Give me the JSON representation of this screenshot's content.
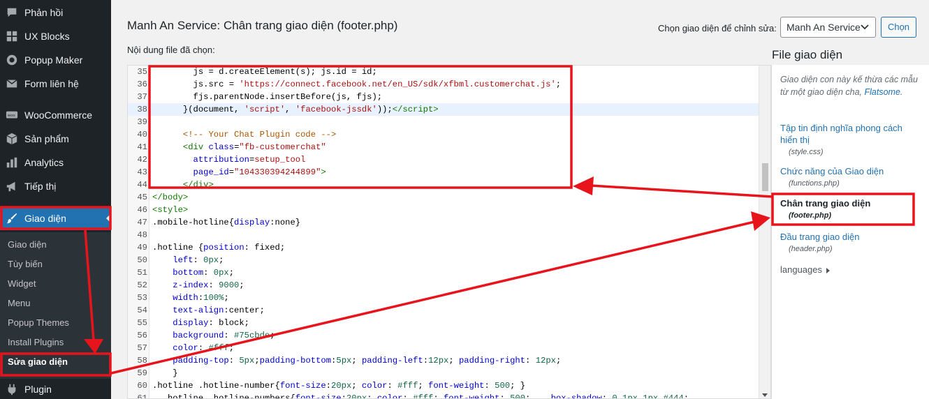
{
  "sidebar": {
    "items": [
      {
        "label": "Phản hồi",
        "icon": "comment-icon"
      },
      {
        "label": "UX Blocks",
        "icon": "blocks-icon"
      },
      {
        "label": "Popup Maker",
        "icon": "popup-icon"
      },
      {
        "label": "Form liên hệ",
        "icon": "mail-icon"
      },
      {
        "label": "WooCommerce",
        "icon": "woo-icon"
      },
      {
        "label": "Sản phẩm",
        "icon": "archive-icon"
      },
      {
        "label": "Analytics",
        "icon": "chart-icon"
      },
      {
        "label": "Tiếp thị",
        "icon": "megaphone-icon"
      },
      {
        "label": "Giao diện",
        "icon": "brush-icon"
      },
      {
        "label": "Plugin",
        "icon": "plugin-icon"
      }
    ],
    "submenu": [
      "Giao diện",
      "Tùy biến",
      "Widget",
      "Menu",
      "Popup Themes",
      "Install Plugins",
      "Sửa giao diện"
    ]
  },
  "header": {
    "title": "Manh An Service: Chân trang giao diện (footer.php)",
    "choose_label": "Chọn giao diện để chỉnh sửa:",
    "select_value": "Manh An Service",
    "choose_button": "Chọn",
    "selected_label": "Nội dung file đã chọn:"
  },
  "editor": {
    "lines": [
      {
        "n": "35",
        "html": "        js = d.createElement(s); js.id = id;"
      },
      {
        "n": "36",
        "html": "        js.src = <span class=\"t-str\">'https://connect.facebook.net/en_US/sdk/xfbml.customerchat.js'</span>;"
      },
      {
        "n": "37",
        "html": "        fjs.parentNode.insertBefore(js, fjs);"
      },
      {
        "n": "38",
        "html": "      }(document, <span class=\"t-str\">'script'</span>, <span class=\"t-str\">'facebook-jssdk'</span>));<span class=\"t-tag\">&lt;/script&gt;</span>",
        "hl": true
      },
      {
        "n": "39",
        "html": ""
      },
      {
        "n": "40",
        "html": "      <span class=\"t-com\">&lt;!-- Your Chat Plugin code --&gt;</span>"
      },
      {
        "n": "41",
        "html": "      <span class=\"t-tag\">&lt;div</span> <span class=\"t-att\">class</span>=<span class=\"t-str\">\"fb-customerchat\"</span>"
      },
      {
        "n": "42",
        "html": "        <span class=\"t-att\">attribution</span>=<span class=\"t-str\">setup_tool</span>"
      },
      {
        "n": "43",
        "html": "        <span class=\"t-att\">page_id</span>=<span class=\"t-str\">\"104330394244899\"</span><span class=\"t-tag\">&gt;</span>"
      },
      {
        "n": "44",
        "html": "      <span class=\"t-tag\">&lt;/div&gt;</span>"
      },
      {
        "n": "45",
        "html": "<span class=\"t-tag\">&lt;/body&gt;</span>"
      },
      {
        "n": "46",
        "html": "<span class=\"t-tag\">&lt;style&gt;</span>"
      },
      {
        "n": "47",
        "html": ".mobile-hotline{<span class=\"t-att\">display</span>:none}"
      },
      {
        "n": "48",
        "html": ""
      },
      {
        "n": "49",
        "html": ".hotline {<span class=\"t-att\">position</span>: fixed;"
      },
      {
        "n": "50",
        "html": "    <span class=\"t-att\">left</span>: <span class=\"t-num\">0px</span>;"
      },
      {
        "n": "51",
        "html": "    <span class=\"t-att\">bottom</span>: <span class=\"t-num\">0px</span>;"
      },
      {
        "n": "52",
        "html": "    <span class=\"t-att\">z-index</span>: <span class=\"t-num\">9000</span>;"
      },
      {
        "n": "53",
        "html": "    <span class=\"t-att\">width</span>:<span class=\"t-num\">100%</span>;"
      },
      {
        "n": "54",
        "html": "    <span class=\"t-att\">text-align</span>:center;"
      },
      {
        "n": "55",
        "html": "    <span class=\"t-att\">display</span>: block;"
      },
      {
        "n": "56",
        "html": "    <span class=\"t-att\">background</span>: <span class=\"t-num\">#75cbde</span>;"
      },
      {
        "n": "57",
        "html": "    <span class=\"t-att\">color</span>: <span class=\"t-num\">#fff</span>;"
      },
      {
        "n": "58",
        "html": "    <span class=\"t-att\">padding-top</span>: <span class=\"t-num\">5px</span>;<span class=\"t-att\">padding-bottom</span>:<span class=\"t-num\">5px</span>; <span class=\"t-att\">padding-left</span>:<span class=\"t-num\">12px</span>; <span class=\"t-att\">padding-right</span>: <span class=\"t-num\">12px</span>;"
      },
      {
        "n": "59",
        "html": "    }"
      },
      {
        "n": "60",
        "html": ".hotline .hotline-number{<span class=\"t-att\">font-size</span>:<span class=\"t-num\">20px</span>; <span class=\"t-att\">color</span>: <span class=\"t-num\">#fff</span>; <span class=\"t-att\">font-weight</span>: <span class=\"t-num\">500</span>; }"
      },
      {
        "n": "61",
        "html": "  .hotline .hotline-numbers{<span class=\"t-att\">font-size</span>:<span class=\"t-num\">20px</span>; <span class=\"t-att\">color</span>: <span class=\"t-num\">#fff</span>; <span class=\"t-att\">font-weight</span>: <span class=\"t-num\">500</span>;    <span class=\"t-att\">box-shadow</span>: <span class=\"t-num\">0 1px 1px #444</span>;"
      }
    ]
  },
  "files": {
    "title": "File giao diện",
    "desc_prefix": "Giao diện con này kế thừa các mẫu từ một giao diện cha,",
    "desc_link": "Flatsome",
    "desc_suffix": ".",
    "items": [
      {
        "name": "Tập tin định nghĩa phong cách hiển thị",
        "path": "(style.css)"
      },
      {
        "name": "Chức năng của Giao diện",
        "path": "(functions.php)"
      },
      {
        "name": "Chân trang giao diện",
        "path": "(footer.php)",
        "current": true
      },
      {
        "name": "Đầu trang giao diện",
        "path": "(header.php)"
      }
    ],
    "languages": "languages"
  },
  "colors": {
    "sidebar_bg": "#1d2327",
    "accent": "#2271b1",
    "annotation_red": "#e8141c"
  }
}
